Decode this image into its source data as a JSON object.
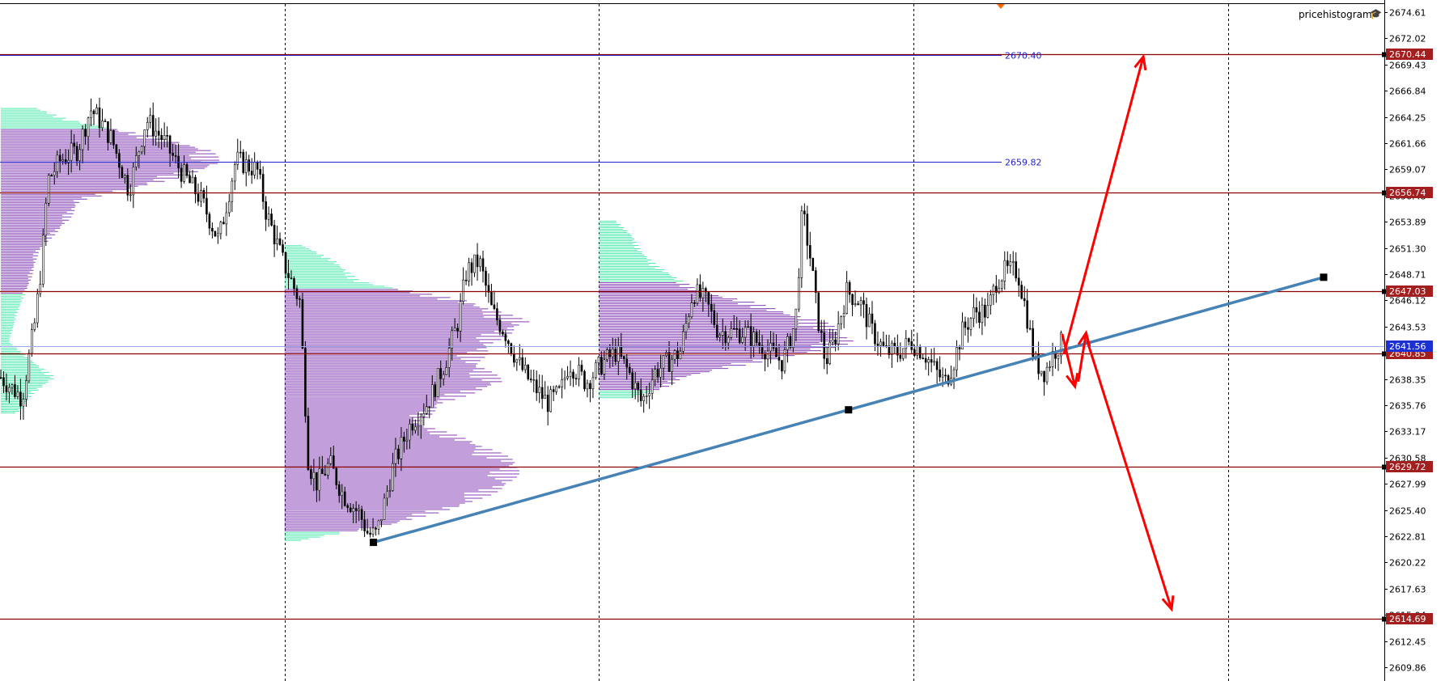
{
  "indicator": {
    "name": "pricehistogram",
    "icon": "mortarboard-icon"
  },
  "colors": {
    "level_line": "#8b0000",
    "level_label_bg": "#a31f1f",
    "current_price_bg": "#1c2fd0",
    "trendline": "#4682b4",
    "arrow": "#ff0000",
    "histogram_purple": "#6f1ea8",
    "histogram_green": "#3ee7a6",
    "blue_line": "#1f1fd0",
    "candles": "#000000",
    "grid": "#000000"
  },
  "chart_data": {
    "type": "candlestick",
    "ylim": [
      2608.5,
      2675.8
    ],
    "y_ticks": [
      "2674.61",
      "2672.02",
      "2669.43",
      "2666.84",
      "2664.25",
      "2661.66",
      "2659.07",
      "2656.48",
      "2653.89",
      "2651.30",
      "2648.71",
      "2646.12",
      "2643.53",
      "2640.94",
      "2638.35",
      "2635.76",
      "2633.17",
      "2630.58",
      "2627.99",
      "2625.40",
      "2622.81",
      "2620.22",
      "2617.63",
      "2615.04",
      "2612.45",
      "2609.86"
    ],
    "horizontal_levels": [
      {
        "price": 2670.44,
        "label": "2670.44"
      },
      {
        "price": 2656.74,
        "label": "2656.74"
      },
      {
        "price": 2647.03,
        "label": "2647.03"
      },
      {
        "price": 2640.85,
        "label": "2640.85"
      },
      {
        "price": 2629.72,
        "label": "2629.72"
      },
      {
        "price": 2614.69,
        "label": "2614.69"
      }
    ],
    "current_price": {
      "price": 2641.56,
      "label": "2641.56"
    },
    "blue_levels": [
      {
        "price": 2670.4,
        "label": "2670.40"
      },
      {
        "price": 2659.82,
        "label": "2659.82"
      }
    ],
    "x_range": [
      0,
      1620
    ],
    "trendline": {
      "points": [
        [
          437,
          2622.2
        ],
        [
          993,
          2635.3
        ],
        [
          1549,
          2648.4
        ]
      ]
    },
    "arrows": [
      {
        "from": [
          1245,
          2640.8
        ],
        "to": [
          1338,
          2670.2
        ]
      },
      {
        "from": [
          1272,
          2642.2
        ],
        "to": [
          1371,
          2615.6
        ]
      }
    ],
    "zigzag": [
      [
        1243,
        2642.8
      ],
      [
        1258,
        2637.6
      ],
      [
        1271,
        2642.9
      ]
    ],
    "vertical_grid_x": [
      333,
      701,
      1069,
      1437
    ],
    "histograms": [
      {
        "x_start": 1,
        "price_low": 2635.0,
        "price_high": 2665.2,
        "green_below": 2646.8,
        "green_above": 2663.0,
        "profile": [
          [
            2635.0,
            20
          ],
          [
            2637.0,
            40
          ],
          [
            2638.5,
            65
          ],
          [
            2640.0,
            40
          ],
          [
            2642.0,
            10
          ],
          [
            2645.0,
            20
          ],
          [
            2648.0,
            35
          ],
          [
            2651.0,
            45
          ],
          [
            2654.0,
            80
          ],
          [
            2656.0,
            95
          ],
          [
            2658.0,
            200
          ],
          [
            2659.5,
            260
          ],
          [
            2661.0,
            250
          ],
          [
            2662.5,
            170
          ],
          [
            2664.0,
            80
          ],
          [
            2665.2,
            40
          ]
        ]
      },
      {
        "x_start": 333,
        "price_low": 2622.4,
        "price_high": 2651.6,
        "green_below": 2623.3,
        "green_above": 2647.2,
        "profile": [
          [
            2622.4,
            20
          ],
          [
            2624.0,
            130
          ],
          [
            2626.0,
            220
          ],
          [
            2628.0,
            270
          ],
          [
            2630.0,
            280
          ],
          [
            2632.0,
            230
          ],
          [
            2634.0,
            160
          ],
          [
            2636.0,
            190
          ],
          [
            2638.0,
            260
          ],
          [
            2640.0,
            230
          ],
          [
            2642.0,
            250
          ],
          [
            2644.0,
            290
          ],
          [
            2646.0,
            220
          ],
          [
            2648.0,
            90
          ],
          [
            2650.0,
            60
          ],
          [
            2651.6,
            20
          ]
        ]
      },
      {
        "x_start": 701,
        "price_low": 2636.5,
        "price_high": 2654.0,
        "green_below": 2637.2,
        "green_above": 2648.0,
        "profile": [
          [
            2636.5,
            40
          ],
          [
            2637.5,
            80
          ],
          [
            2638.5,
            100
          ],
          [
            2640.0,
            190
          ],
          [
            2641.0,
            260
          ],
          [
            2642.0,
            300
          ],
          [
            2643.0,
            290
          ],
          [
            2644.0,
            265
          ],
          [
            2645.0,
            220
          ],
          [
            2646.0,
            180
          ],
          [
            2647.0,
            120
          ],
          [
            2648.0,
            100
          ],
          [
            2649.5,
            70
          ],
          [
            2651.0,
            50
          ],
          [
            2652.5,
            40
          ],
          [
            2654.0,
            20
          ]
        ]
      }
    ],
    "candles": []
  }
}
